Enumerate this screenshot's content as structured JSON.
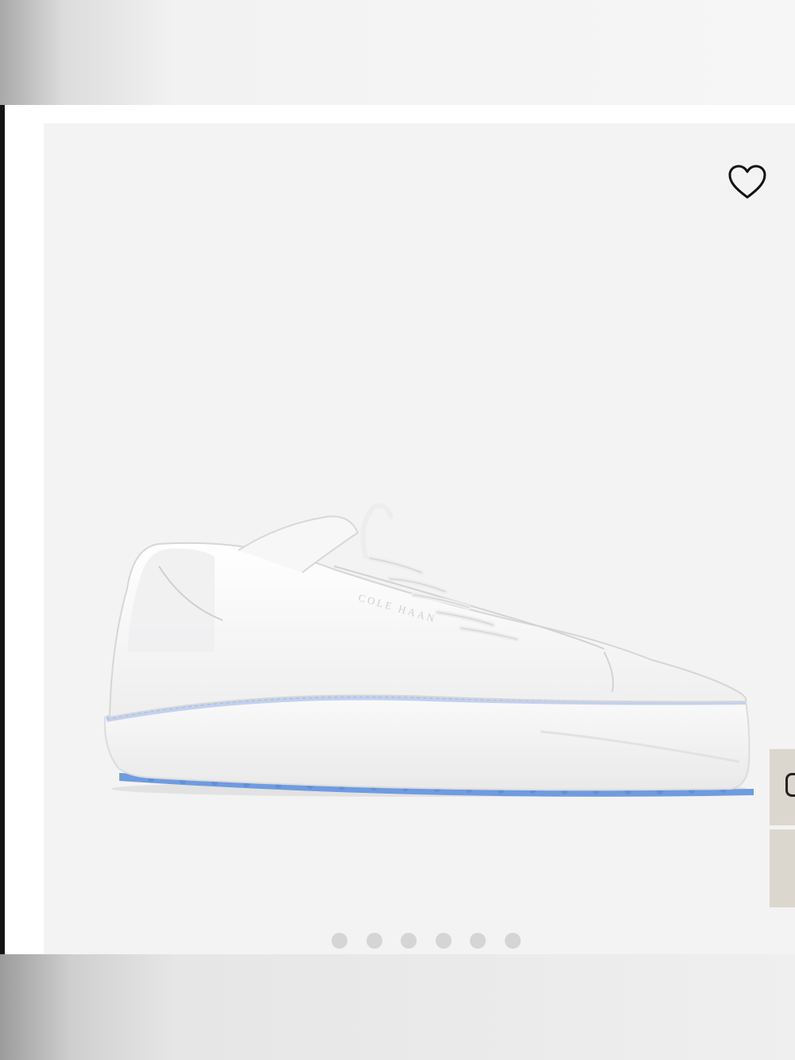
{
  "product": {
    "brand_mark": "COLE HAAN",
    "image_name": "shoe-product-image"
  },
  "wishlist": {
    "icon": "heart-outline-icon"
  },
  "carousel": {
    "slide_count": 6,
    "active_index": 0
  },
  "side_tabs": [
    {
      "icon": "chat-icon"
    },
    {
      "icon": ""
    }
  ],
  "colors": {
    "background": "#f3f3f3",
    "dot": "#d5d5d5",
    "side_tab": "#dcd7ce",
    "sole_accent": "#6f9be0",
    "welt_accent": "#c3d1ef"
  }
}
